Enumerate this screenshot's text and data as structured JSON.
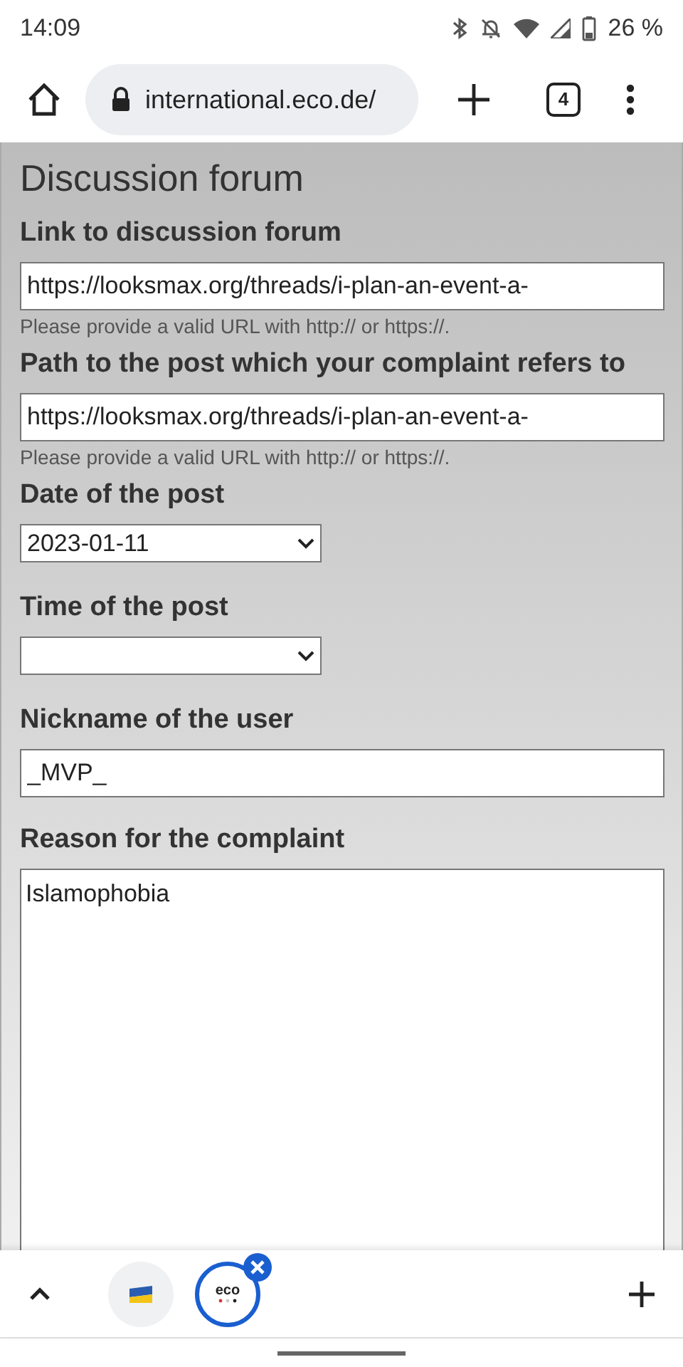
{
  "status_bar": {
    "time": "14:09",
    "battery": "26 %"
  },
  "toolbar": {
    "url": "international.eco.de/",
    "tab_count": "4"
  },
  "form": {
    "title": "Discussion forum",
    "fields": [
      {
        "kind": "text",
        "label": "Link to discussion forum",
        "value": "https://looksmax.org/threads/i-plan-an-event-a-",
        "hint": "Please provide a valid URL with http:// or https://."
      },
      {
        "kind": "text",
        "label": "Path to the post which your complaint refers to",
        "value": "https://looksmax.org/threads/i-plan-an-event-a-",
        "hint": "Please provide a valid URL with http:// or https://."
      },
      {
        "kind": "select",
        "label": "Date of the post",
        "value": "2023-01-11"
      },
      {
        "kind": "select",
        "label": "Time of the post"
      },
      {
        "kind": "text",
        "label": "Nickname of the user",
        "value": "_MVP_"
      },
      {
        "kind": "textarea",
        "label": "Reason for the complaint",
        "value": "Islamophobia"
      }
    ]
  },
  "tab_strip": {
    "tabs": [
      {
        "selected": false
      },
      {
        "selected": true,
        "logo": "eco"
      }
    ]
  }
}
